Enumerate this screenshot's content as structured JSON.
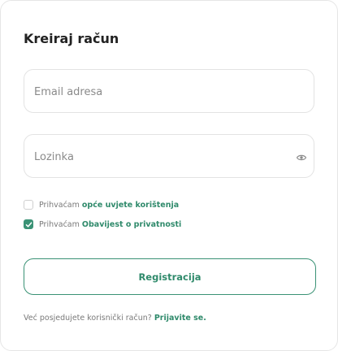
{
  "form": {
    "title": "Kreiraj račun",
    "email_placeholder": "Email adresa",
    "password_placeholder": "Lozinka",
    "terms": {
      "prefix": "Prihvaćam",
      "link": "opće uvjete korištenja",
      "checked": false
    },
    "privacy": {
      "prefix": "Prihvaćam",
      "link": "Obavijest o privatnosti",
      "checked": true
    },
    "submit_label": "Registracija",
    "footer_text": "Već posjedujete korisnički račun?",
    "footer_link": "Prijavite se."
  },
  "colors": {
    "accent": "#3a9275",
    "border": "#e3e3e3"
  },
  "icons": {
    "password_toggle": "eye-icon",
    "checkbox_mark": "check-icon"
  }
}
